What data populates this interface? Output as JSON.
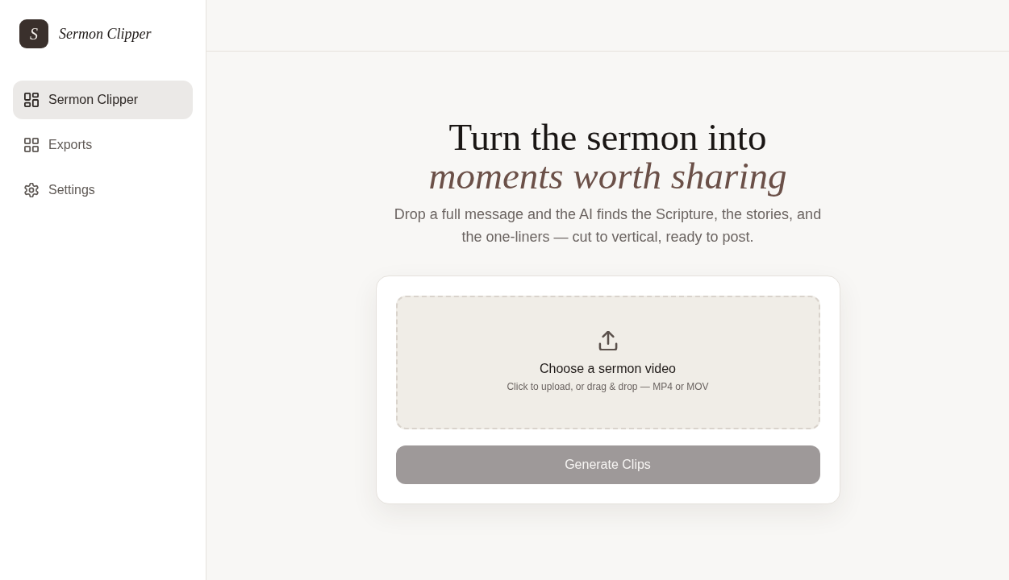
{
  "brand": {
    "logo_letter": "S",
    "name": "Sermon Clipper"
  },
  "sidebar": {
    "items": [
      {
        "label": "Sermon Clipper",
        "selected": true
      },
      {
        "label": "Exports",
        "selected": false
      },
      {
        "label": "Settings",
        "selected": false
      }
    ]
  },
  "hero": {
    "title": "Turn the sermon into *moments worth sharing*",
    "subtitle": "Drop a full message and the AI finds the Scripture, the stories, and the one-liners — cut to vertical, ready to post."
  },
  "upload": {
    "title": "Choose a sermon video",
    "hint": "Click to upload, or drag & drop — MP4 or MOV"
  },
  "generate_button": {
    "label": "Generate Clips",
    "disabled": true
  }
}
